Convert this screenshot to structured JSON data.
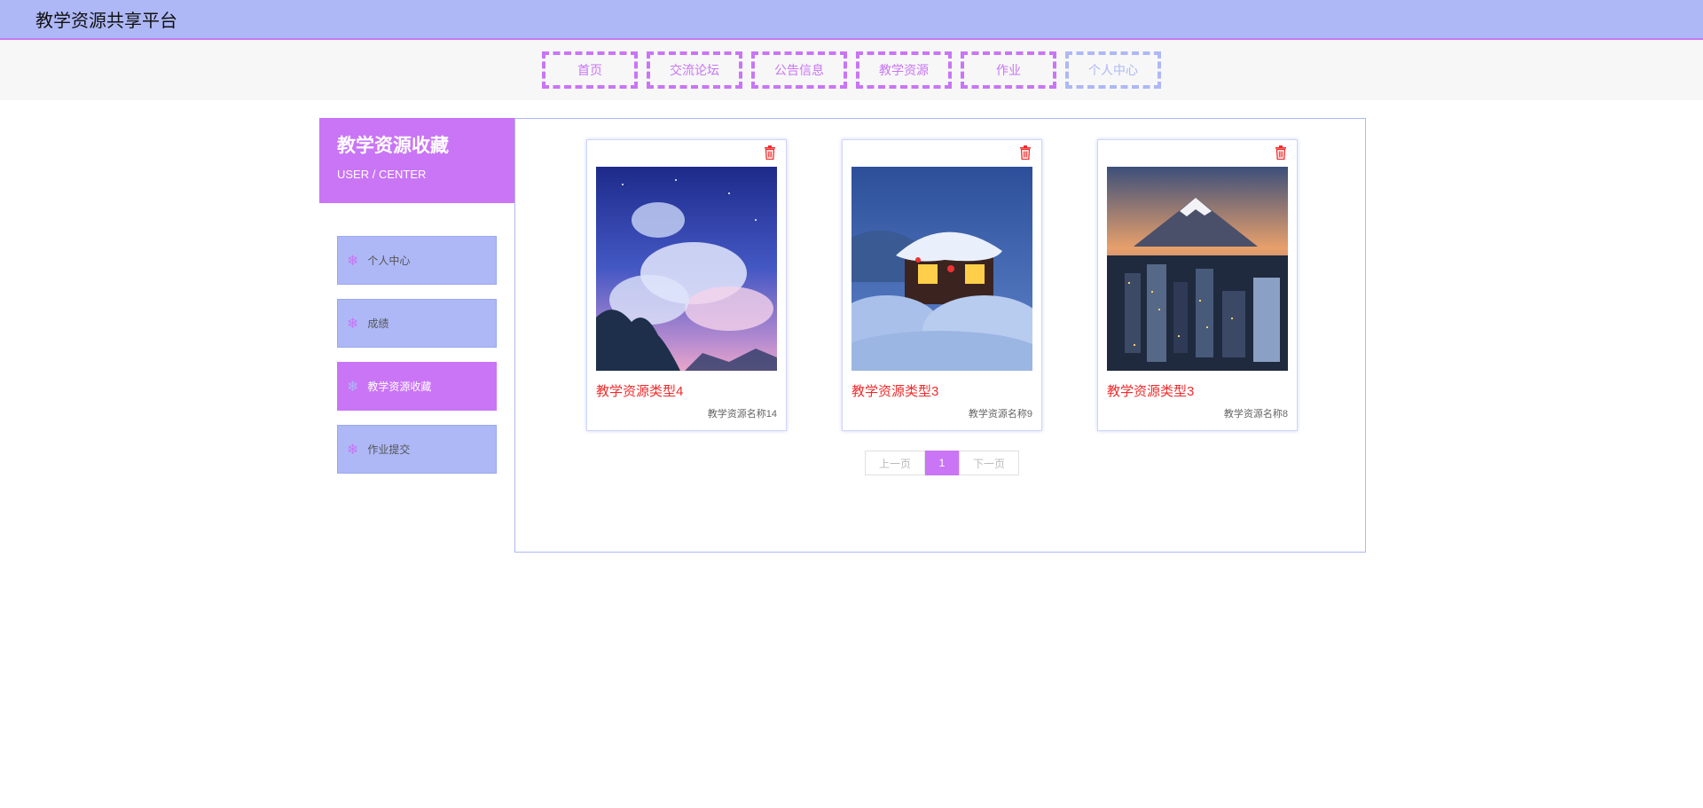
{
  "header": {
    "title": "教学资源共享平台"
  },
  "nav": {
    "items": [
      {
        "label": "首页",
        "active": false
      },
      {
        "label": "交流论坛",
        "active": false
      },
      {
        "label": "公告信息",
        "active": false
      },
      {
        "label": "教学资源",
        "active": false
      },
      {
        "label": "作业",
        "active": false
      },
      {
        "label": "个人中心",
        "active": true
      }
    ]
  },
  "sidebar": {
    "title": "教学资源收藏",
    "subtitle": "USER / CENTER",
    "items": [
      {
        "label": "个人中心",
        "icon": "snowflake-icon",
        "active": false
      },
      {
        "label": "成绩",
        "icon": "snowflake-icon",
        "active": false
      },
      {
        "label": "教学资源收藏",
        "icon": "snowflake-icon",
        "active": true
      },
      {
        "label": "作业提交",
        "icon": "snowflake-icon",
        "active": false
      }
    ]
  },
  "cards": [
    {
      "type": "教学资源类型4",
      "name": "教学资源名称14",
      "image": "night-sky-clouds-image",
      "delete_icon": "trash-icon"
    },
    {
      "type": "教学资源类型3",
      "name": "教学资源名称9",
      "image": "snowy-cabin-image",
      "delete_icon": "trash-icon"
    },
    {
      "type": "教学资源类型3",
      "name": "教学资源名称8",
      "image": "mount-fuji-city-image",
      "delete_icon": "trash-icon"
    }
  ],
  "pagination": {
    "prev": "上一页",
    "current": "1",
    "next": "下一页"
  },
  "colors": {
    "primary": "#c975f6",
    "secondary": "#aeb8f6",
    "danger": "#f12b2b"
  }
}
